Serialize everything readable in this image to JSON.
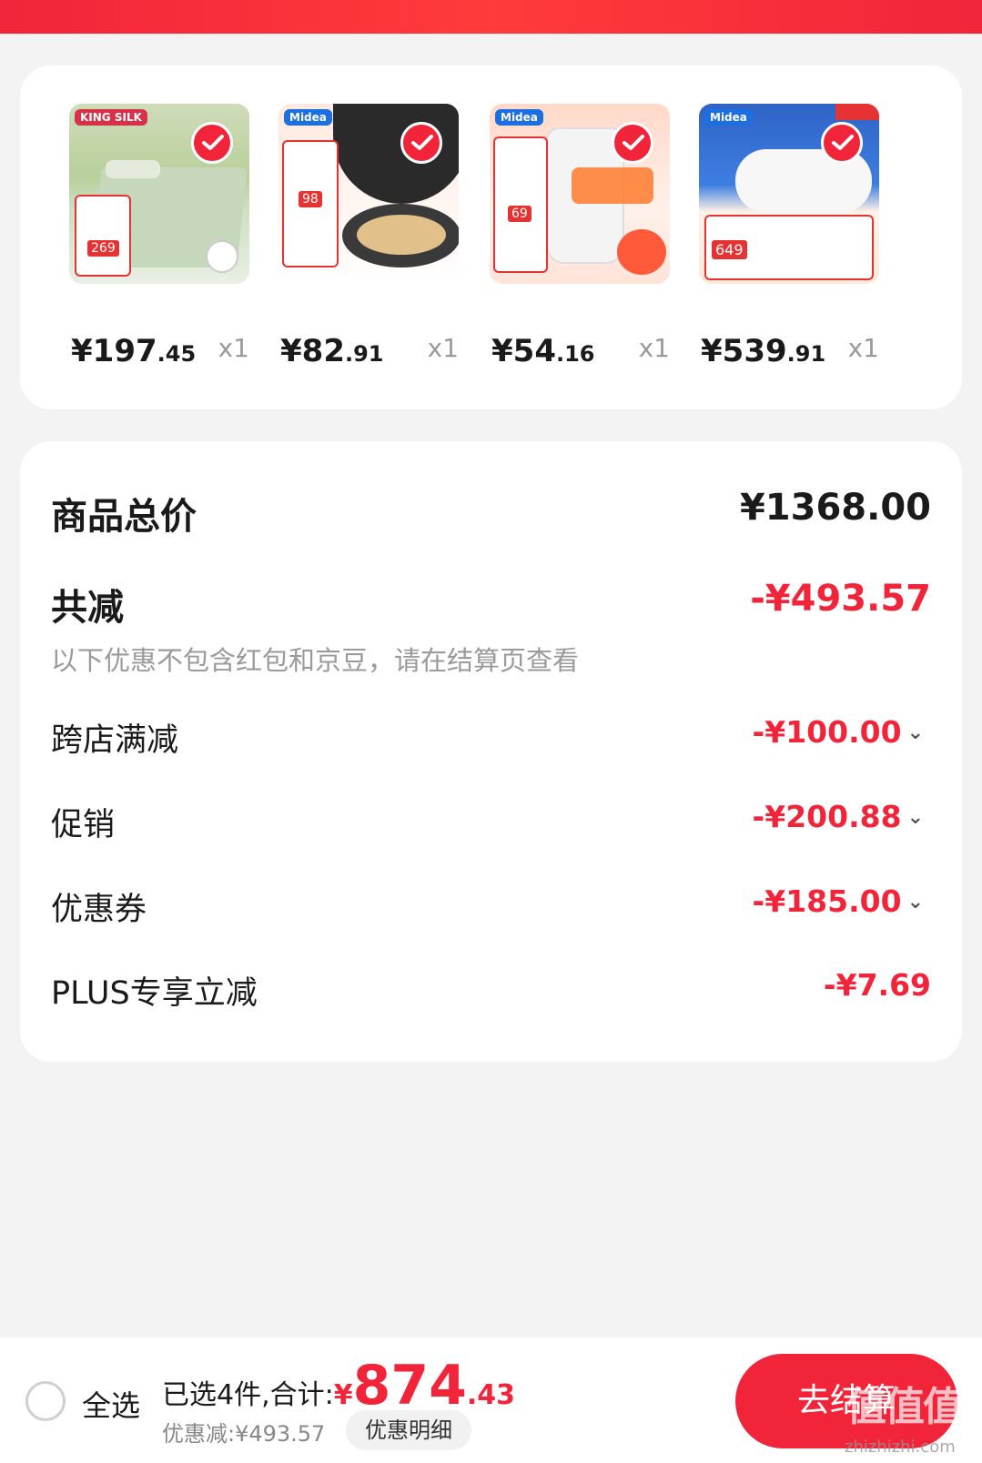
{
  "products": [
    {
      "id": "p1",
      "price_int": "¥197",
      "price_dec": ".45",
      "qty": "x1",
      "icon": "bedding-image",
      "brand": "KING SILK",
      "tag": "269"
    },
    {
      "id": "p2",
      "price_int": "¥82",
      "price_dec": ".91",
      "qty": "x1",
      "icon": "pan-image",
      "brand": "Midea",
      "tag": "98"
    },
    {
      "id": "p3",
      "price_int": "¥54",
      "price_dec": ".16",
      "qty": "x1",
      "icon": "kettle-image",
      "brand": "Midea",
      "tag": "69"
    },
    {
      "id": "p4",
      "price_int": "¥539",
      "price_dec": ".91",
      "qty": "x1",
      "icon": "water-heater-image",
      "brand": "Midea",
      "tag": "649"
    }
  ],
  "summary": {
    "total_label": "商品总价",
    "total_value": "¥1368.00",
    "reduce_label": "共减",
    "reduce_value": "-¥493.57",
    "note": "以下优惠不包含红包和京豆，请在结算页查看",
    "items": [
      {
        "label": "跨店满减",
        "value": "-¥100.00",
        "expandable": true
      },
      {
        "label": "促销",
        "value": "-¥200.88",
        "expandable": true
      },
      {
        "label": "优惠券",
        "value": "-¥185.00",
        "expandable": true
      },
      {
        "label": "PLUS专享立减",
        "value": "-¥7.69",
        "expandable": false
      }
    ]
  },
  "bottom": {
    "select_all": "全选",
    "total_prefix": "已选4件,合计:",
    "total_currency": "¥",
    "total_int": "874",
    "total_dec": ".43",
    "discount": "优惠减:¥493.57",
    "detail_button": "优惠明细",
    "checkout_button": "去结算"
  },
  "watermark": {
    "text": "值值值",
    "site": "zhizhizhi.com"
  },
  "colors": {
    "accent": "#f2243a",
    "background": "#f3f3f3"
  }
}
